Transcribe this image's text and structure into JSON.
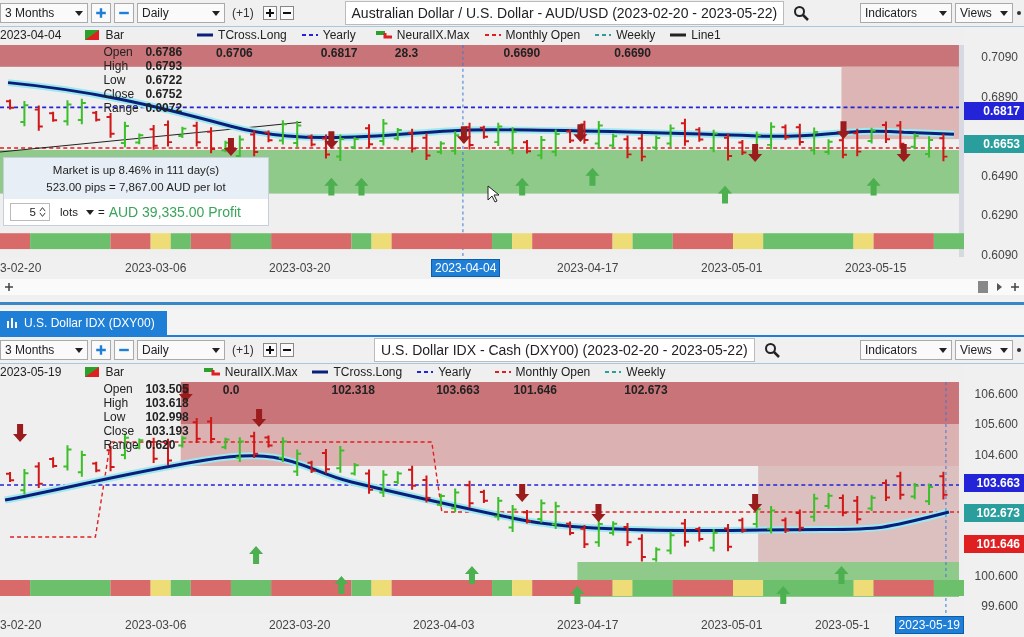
{
  "charts": [
    {
      "toolbar": {
        "range": "3 Months",
        "interval": "Daily",
        "offset": "(+1)",
        "title": "Australian Dollar / U.S. Dollar - AUD/USD (2023-02-20 - 2023-05-22)",
        "indicators": "Indicators",
        "views": "Views"
      },
      "legend": {
        "date": "2023-04-04",
        "items": [
          {
            "kind": "bar",
            "label": "Bar",
            "value": null,
            "color": "#2ba02b"
          },
          {
            "kind": "line",
            "label": "TCross.Long",
            "value": "0.6706",
            "color": "#0b1f7a"
          },
          {
            "kind": "dashed",
            "label": "Yearly",
            "value": "0.6817",
            "color": "#2323d8"
          },
          {
            "kind": "step",
            "label": "NeuralIX.Max",
            "value": "28.3",
            "color": "#2ba02b"
          },
          {
            "kind": "dashed",
            "label": "Monthly Open",
            "value": "0.6690",
            "color": "#e02020"
          },
          {
            "kind": "dashed",
            "label": "Weekly",
            "value": "0.6690",
            "color": "#2a9d9d"
          },
          {
            "kind": "line",
            "label": "Line1",
            "value": null,
            "color": "#222222"
          }
        ]
      },
      "ohlc": [
        {
          "label": "Open",
          "value": "0.6786"
        },
        {
          "label": "High",
          "value": "0.6793"
        },
        {
          "label": "Low",
          "value": "0.6722"
        },
        {
          "label": "Close",
          "value": "0.6752"
        },
        {
          "label": "Range",
          "value": "0.0072"
        }
      ],
      "y_ticks": [
        "0.7090",
        "0.6890",
        "0.6490",
        "0.6290",
        "0.6090"
      ],
      "price_tags": [
        {
          "value": "0.6817",
          "color": "#2323d8"
        },
        {
          "value": "0.6653",
          "color": "#2a9d9d"
        }
      ],
      "x_ticks": [
        {
          "label": "3-02-20",
          "selected": false
        },
        {
          "label": "2023-03-06",
          "selected": false
        },
        {
          "label": "2023-03-20",
          "selected": false
        },
        {
          "label": "2023-04-04",
          "selected": true
        },
        {
          "label": "2023-04-17",
          "selected": false
        },
        {
          "label": "2023-05-01",
          "selected": false
        },
        {
          "label": "2023-05-15",
          "selected": false
        }
      ],
      "info": {
        "lines": [
          "Market is up 8.46% in 111 day(s)",
          "523.00 pips = 7,867.00 AUD per lot"
        ],
        "quantity": "5",
        "unit": "lots",
        "equals": "=",
        "profit": "AUD 39,335.00 Profit"
      }
    },
    {
      "tab": "U.S. Dollar IDX (DXY00)",
      "toolbar": {
        "range": "3 Months",
        "interval": "Daily",
        "offset": "(+1)",
        "title": "U.S. Dollar IDX - Cash (DXY00) (2023-02-20 - 2023-05-22)",
        "indicators": "Indicators",
        "views": "Views"
      },
      "legend": {
        "date": "2023-05-19",
        "items": [
          {
            "kind": "bar",
            "label": "Bar",
            "value": null,
            "color": "#2ba02b"
          },
          {
            "kind": "step",
            "label": "NeuralIX.Max",
            "value": "0.0",
            "color": "#2ba02b"
          },
          {
            "kind": "line",
            "label": "TCross.Long",
            "value": "102.318",
            "color": "#0b1f7a"
          },
          {
            "kind": "dashed",
            "label": "Yearly",
            "value": "103.663",
            "color": "#2323d8"
          },
          {
            "kind": "dashed",
            "label": "Monthly Open",
            "value": "101.646",
            "color": "#e02020"
          },
          {
            "kind": "dashed",
            "label": "Weekly",
            "value": "102.673",
            "color": "#2a9d9d"
          }
        ]
      },
      "ohlc": [
        {
          "label": "Open",
          "value": "103.505"
        },
        {
          "label": "High",
          "value": "103.618"
        },
        {
          "label": "Low",
          "value": "102.998"
        },
        {
          "label": "Close",
          "value": "103.193"
        },
        {
          "label": "Range",
          "value": "0.620"
        }
      ],
      "y_ticks": [
        "106.600",
        "105.600",
        "104.600",
        "100.600",
        "99.600"
      ],
      "price_tags": [
        {
          "value": "103.663",
          "color": "#2323d8"
        },
        {
          "value": "102.673",
          "color": "#2a9d9d"
        },
        {
          "value": "101.646",
          "color": "#e02020"
        }
      ],
      "x_ticks": [
        {
          "label": "3-02-20",
          "selected": false
        },
        {
          "label": "2023-03-06",
          "selected": false
        },
        {
          "label": "2023-03-20",
          "selected": false
        },
        {
          "label": "2023-04-03",
          "selected": false
        },
        {
          "label": "2023-04-17",
          "selected": false
        },
        {
          "label": "2023-05-01",
          "selected": false
        },
        {
          "label": "2023-05-1",
          "selected": false
        },
        {
          "label": "2023-05-19",
          "selected": true
        }
      ]
    }
  ]
}
